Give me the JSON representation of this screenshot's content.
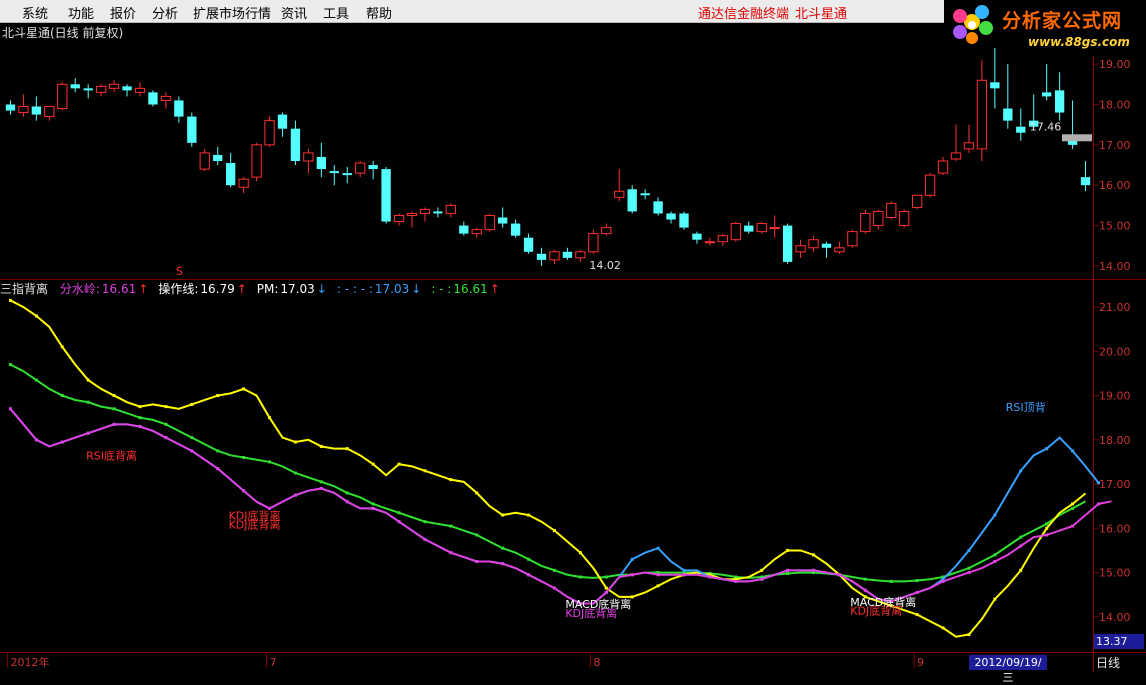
{
  "menu": {
    "items": [
      "系统",
      "功能",
      "报价",
      "分析",
      "扩展市场行情",
      "资讯",
      "工具",
      "帮助"
    ],
    "links": [
      "通达信金融终端",
      "北斗星通"
    ]
  },
  "logo": {
    "title": "分析家公式网",
    "url": "www.88gs.com"
  },
  "main_chart": {
    "title": "北斗星通(日线 前复权)"
  },
  "indicator": {
    "name": "三指背离",
    "items": [
      {
        "label": "分水岭:",
        "value": "16.61",
        "arrow": "↑",
        "color": "#e040e0",
        "arrow_color": "#ff3030"
      },
      {
        "label": "操作线:",
        "value": "16.79",
        "arrow": "↑",
        "color": "#ffffff",
        "arrow_color": "#ff3030"
      },
      {
        "label": "PM:",
        "value": "17.03",
        "arrow": "↓",
        "color": "#ffffff",
        "arrow_color": "#3aa0ff"
      },
      {
        "label": ": - : - :",
        "value": "17.03",
        "arrow": "↓",
        "color": "#3aa0ff",
        "arrow_color": "#3aa0ff"
      },
      {
        "label": ": - :",
        "value": "16.61",
        "arrow": "↑",
        "color": "#30e030",
        "arrow_color": "#ff3030"
      }
    ]
  },
  "status": {
    "period": "日线",
    "date": "2012/09/19/三",
    "cursor_price": "13.37"
  },
  "colors": {
    "up": "#ff3030",
    "down": "#54ffff",
    "grid": "#7a0000"
  },
  "chart_data": [
    {
      "type": "candlestick",
      "title": "北斗星通(日线 前复权)",
      "ylim": [
        13.8,
        19.35
      ],
      "yticks": [
        14.0,
        15.0,
        16.0,
        17.0,
        18.0,
        19.0
      ],
      "ytick_labels": [
        "14.00",
        "15.00",
        "16.00",
        "17.00",
        "18.00",
        "19.00"
      ],
      "xtick_labels": [
        "2012年",
        "7",
        "8",
        "9"
      ],
      "xtick_index": [
        0,
        20,
        45,
        70
      ],
      "annotations": [
        {
          "text": "17.46",
          "index": 79,
          "value": 17.46
        },
        {
          "text": "14.02",
          "index": 45,
          "value": 14.02
        },
        {
          "text": "S",
          "index": 13,
          "value": 13.8
        }
      ],
      "ohlc": [
        [
          18.0,
          18.1,
          17.75,
          17.85
        ],
        [
          17.8,
          18.25,
          17.7,
          17.95
        ],
        [
          17.95,
          18.2,
          17.6,
          17.75
        ],
        [
          17.7,
          17.95,
          17.6,
          17.95
        ],
        [
          17.9,
          18.55,
          17.85,
          18.5
        ],
        [
          18.5,
          18.65,
          18.3,
          18.4
        ],
        [
          18.4,
          18.5,
          18.15,
          18.35
        ],
        [
          18.3,
          18.5,
          18.2,
          18.45
        ],
        [
          18.4,
          18.6,
          18.3,
          18.5
        ],
        [
          18.45,
          18.5,
          18.2,
          18.35
        ],
        [
          18.3,
          18.55,
          18.2,
          18.4
        ],
        [
          18.3,
          18.35,
          17.95,
          18.0
        ],
        [
          18.1,
          18.3,
          17.9,
          18.2
        ],
        [
          18.1,
          18.2,
          17.55,
          17.7
        ],
        [
          17.7,
          17.8,
          16.95,
          17.05
        ],
        [
          16.4,
          16.9,
          16.35,
          16.8
        ],
        [
          16.75,
          16.95,
          16.5,
          16.6
        ],
        [
          16.55,
          16.8,
          15.95,
          16.0
        ],
        [
          15.95,
          16.2,
          15.8,
          16.15
        ],
        [
          16.2,
          17.05,
          16.1,
          17.0
        ],
        [
          17.0,
          17.7,
          16.95,
          17.6
        ],
        [
          17.75,
          17.8,
          17.2,
          17.4
        ],
        [
          17.4,
          17.6,
          16.5,
          16.6
        ],
        [
          16.6,
          16.9,
          16.3,
          16.8
        ],
        [
          16.7,
          17.05,
          16.2,
          16.4
        ],
        [
          16.35,
          16.5,
          16.0,
          16.3
        ],
        [
          16.3,
          16.45,
          16.05,
          16.25
        ],
        [
          16.3,
          16.6,
          16.2,
          16.55
        ],
        [
          16.5,
          16.6,
          16.15,
          16.4
        ],
        [
          16.4,
          16.45,
          15.05,
          15.1
        ],
        [
          15.1,
          15.3,
          15.0,
          15.25
        ],
        [
          15.25,
          15.35,
          14.95,
          15.3
        ],
        [
          15.3,
          15.45,
          15.1,
          15.4
        ],
        [
          15.35,
          15.45,
          15.2,
          15.3
        ],
        [
          15.3,
          15.55,
          15.2,
          15.5
        ],
        [
          15.0,
          15.1,
          14.75,
          14.8
        ],
        [
          14.8,
          14.95,
          14.7,
          14.9
        ],
        [
          14.9,
          15.3,
          14.85,
          15.25
        ],
        [
          15.2,
          15.45,
          14.95,
          15.05
        ],
        [
          15.05,
          15.15,
          14.7,
          14.75
        ],
        [
          14.7,
          14.8,
          14.3,
          14.35
        ],
        [
          14.3,
          14.45,
          14.0,
          14.15
        ],
        [
          14.15,
          14.4,
          14.05,
          14.35
        ],
        [
          14.35,
          14.45,
          14.15,
          14.2
        ],
        [
          14.2,
          14.4,
          14.1,
          14.35
        ],
        [
          14.35,
          14.9,
          14.3,
          14.8
        ],
        [
          14.8,
          15.05,
          14.75,
          14.95
        ],
        [
          15.7,
          16.4,
          15.6,
          15.85
        ],
        [
          15.9,
          16.0,
          15.3,
          15.35
        ],
        [
          15.8,
          15.9,
          15.65,
          15.75
        ],
        [
          15.6,
          15.7,
          15.25,
          15.3
        ],
        [
          15.3,
          15.35,
          15.05,
          15.15
        ],
        [
          15.3,
          15.35,
          14.9,
          14.95
        ],
        [
          14.8,
          14.85,
          14.55,
          14.65
        ],
        [
          14.6,
          14.7,
          14.5,
          14.6
        ],
        [
          14.6,
          14.8,
          14.5,
          14.75
        ],
        [
          14.65,
          15.1,
          14.6,
          15.05
        ],
        [
          15.0,
          15.1,
          14.8,
          14.85
        ],
        [
          14.85,
          15.1,
          14.8,
          15.05
        ],
        [
          14.95,
          15.25,
          14.7,
          14.95
        ],
        [
          15.0,
          15.05,
          14.05,
          14.1
        ],
        [
          14.35,
          14.65,
          14.2,
          14.5
        ],
        [
          14.45,
          14.75,
          14.35,
          14.65
        ],
        [
          14.55,
          14.6,
          14.2,
          14.45
        ],
        [
          14.35,
          14.6,
          14.3,
          14.45
        ],
        [
          14.5,
          14.9,
          14.45,
          14.85
        ],
        [
          14.85,
          15.4,
          14.8,
          15.3
        ],
        [
          15.0,
          15.4,
          14.9,
          15.35
        ],
        [
          15.2,
          15.6,
          15.15,
          15.55
        ],
        [
          15.0,
          15.4,
          14.95,
          15.35
        ],
        [
          15.45,
          15.75,
          15.4,
          15.75
        ],
        [
          15.75,
          16.3,
          15.7,
          16.25
        ],
        [
          16.3,
          16.7,
          16.25,
          16.6
        ],
        [
          16.65,
          17.5,
          16.6,
          16.8
        ],
        [
          16.9,
          17.5,
          16.8,
          17.05
        ],
        [
          16.9,
          19.1,
          16.6,
          18.6
        ],
        [
          18.55,
          19.4,
          17.9,
          18.4
        ],
        [
          17.9,
          19.0,
          17.4,
          17.6
        ],
        [
          17.45,
          17.9,
          17.1,
          17.3
        ],
        [
          17.6,
          18.25,
          17.4,
          17.45
        ],
        [
          18.3,
          19.0,
          18.1,
          18.2
        ],
        [
          18.35,
          18.8,
          17.6,
          17.8
        ],
        [
          17.25,
          18.1,
          16.9,
          17.0
        ],
        [
          16.2,
          16.6,
          15.85,
          16.0
        ]
      ]
    },
    {
      "type": "line",
      "title": "三指背离",
      "ylim": [
        13.25,
        21.25
      ],
      "yticks": [
        14.0,
        15.0,
        16.0,
        17.0,
        18.0,
        19.0,
        20.0,
        21.0
      ],
      "ytick_labels": [
        "14.00",
        "15.00",
        "16.00",
        "17.00",
        "18.00",
        "19.00",
        "20.00",
        "21.00"
      ],
      "series": [
        {
          "name": "分水岭",
          "color": "#e040e0",
          "values": [
            18.7,
            18.35,
            18.0,
            17.85,
            17.95,
            18.05,
            18.15,
            18.25,
            18.35,
            18.35,
            18.3,
            18.2,
            18.05,
            17.9,
            17.75,
            17.55,
            17.35,
            17.1,
            16.85,
            16.6,
            16.45,
            16.6,
            16.75,
            16.85,
            16.9,
            16.8,
            16.6,
            16.45,
            16.45,
            16.35,
            16.15,
            15.95,
            15.75,
            15.6,
            15.45,
            15.35,
            15.25,
            15.25,
            15.2,
            15.1,
            14.95,
            14.8,
            14.65,
            14.45,
            14.3,
            14.3,
            14.55,
            14.9,
            14.95,
            15.0,
            14.95,
            14.95,
            14.95,
            14.95,
            14.9,
            14.85,
            14.8,
            14.8,
            14.85,
            14.95,
            15.05,
            15.05,
            15.05,
            15.0,
            14.95,
            14.8,
            14.6,
            14.4,
            14.35,
            14.45,
            14.55,
            14.65,
            14.8,
            14.9,
            15.0,
            15.1,
            15.25,
            15.4,
            15.6,
            15.8,
            15.85,
            15.95,
            16.05,
            16.3,
            16.55,
            16.61
          ]
        },
        {
          "name": "操作线",
          "color": "#ffff00",
          "values": [
            21.15,
            21.0,
            20.8,
            20.55,
            20.1,
            19.7,
            19.35,
            19.15,
            19.0,
            18.85,
            18.75,
            18.8,
            18.75,
            18.7,
            18.8,
            18.9,
            19.0,
            19.05,
            19.15,
            19.0,
            18.5,
            18.05,
            17.95,
            18.0,
            17.85,
            17.8,
            17.8,
            17.65,
            17.45,
            17.2,
            17.45,
            17.4,
            17.3,
            17.2,
            17.1,
            17.05,
            16.8,
            16.5,
            16.3,
            16.35,
            16.3,
            16.15,
            15.95,
            15.7,
            15.45,
            15.1,
            14.65,
            14.45,
            14.45,
            14.55,
            14.7,
            14.85,
            14.95,
            15.0,
            14.95,
            14.85,
            14.85,
            14.9,
            15.05,
            15.3,
            15.5,
            15.5,
            15.4,
            15.2,
            14.95,
            14.65,
            14.45,
            14.35,
            14.25,
            14.15,
            14.05,
            13.9,
            13.75,
            13.55,
            13.6,
            13.95,
            14.4,
            14.7,
            15.05,
            15.55,
            16.0,
            16.35,
            16.55,
            16.79
          ]
        },
        {
          "name": "PM",
          "color": "#3aa0ff",
          "values": [
            18.7,
            18.35,
            18.0,
            17.85,
            17.95,
            18.05,
            18.15,
            18.25,
            18.35,
            18.35,
            18.3,
            18.2,
            18.05,
            17.9,
            17.75,
            17.55,
            17.35,
            17.1,
            16.85,
            16.6,
            16.45,
            16.6,
            16.75,
            16.85,
            16.9,
            16.8,
            16.6,
            16.45,
            16.45,
            16.35,
            16.15,
            15.95,
            15.75,
            15.6,
            15.45,
            15.35,
            15.25,
            15.25,
            15.2,
            15.1,
            14.95,
            14.8,
            14.65,
            14.45,
            14.3,
            14.3,
            14.55,
            14.9,
            15.3,
            15.45,
            15.55,
            15.25,
            15.05,
            15.05,
            14.9,
            14.85,
            14.8,
            14.8,
            14.85,
            14.95,
            15.05,
            15.05,
            15.05,
            15.0,
            14.95,
            14.8,
            14.6,
            14.4,
            14.35,
            14.45,
            14.55,
            14.65,
            14.85,
            15.15,
            15.5,
            15.9,
            16.3,
            16.8,
            17.3,
            17.65,
            17.8,
            18.05,
            17.75,
            17.4,
            17.03
          ]
        },
        {
          "name": "均线",
          "color": "#30e030",
          "values": [
            19.7,
            19.55,
            19.35,
            19.15,
            19.0,
            18.9,
            18.85,
            18.75,
            18.7,
            18.6,
            18.5,
            18.45,
            18.35,
            18.2,
            18.05,
            17.9,
            17.75,
            17.65,
            17.6,
            17.55,
            17.5,
            17.4,
            17.25,
            17.15,
            17.05,
            16.95,
            16.8,
            16.7,
            16.55,
            16.45,
            16.35,
            16.25,
            16.15,
            16.1,
            16.05,
            15.95,
            15.85,
            15.7,
            15.55,
            15.45,
            15.3,
            15.15,
            15.05,
            14.95,
            14.9,
            14.88,
            14.9,
            14.95,
            14.95,
            15.0,
            15.0,
            15.0,
            15.0,
            15.0,
            14.98,
            14.95,
            14.9,
            14.88,
            14.9,
            14.95,
            14.98,
            15.0,
            15.0,
            14.98,
            14.95,
            14.9,
            14.85,
            14.82,
            14.8,
            14.8,
            14.82,
            14.85,
            14.9,
            15.0,
            15.1,
            15.25,
            15.4,
            15.6,
            15.8,
            15.95,
            16.1,
            16.3,
            16.45,
            16.61
          ]
        }
      ],
      "annotations": [
        {
          "text": "RSI底背离",
          "index": 8,
          "value": 17.55,
          "color": "#ff3030"
        },
        {
          "text": "KDJ底背离",
          "index": 19,
          "value": 16.2,
          "color": "#ff3030"
        },
        {
          "text": "KDJ底背离",
          "index": 19,
          "value": 16.0,
          "color": "#ff3030"
        },
        {
          "text": "MACD底背离",
          "index": 45,
          "value": 14.2,
          "color": "#ffffff"
        },
        {
          "text": "KDJ底背离",
          "index": 45,
          "value": 14.0,
          "color": "#e040e0"
        },
        {
          "text": "MACD底背离",
          "index": 67,
          "value": 14.25,
          "color": "#ffffff"
        },
        {
          "text": "KDJ底背离",
          "index": 67,
          "value": 14.05,
          "color": "#ff3030"
        },
        {
          "text": "RSI顶背",
          "index": 79,
          "value": 18.65,
          "color": "#3aa0ff"
        }
      ]
    }
  ]
}
